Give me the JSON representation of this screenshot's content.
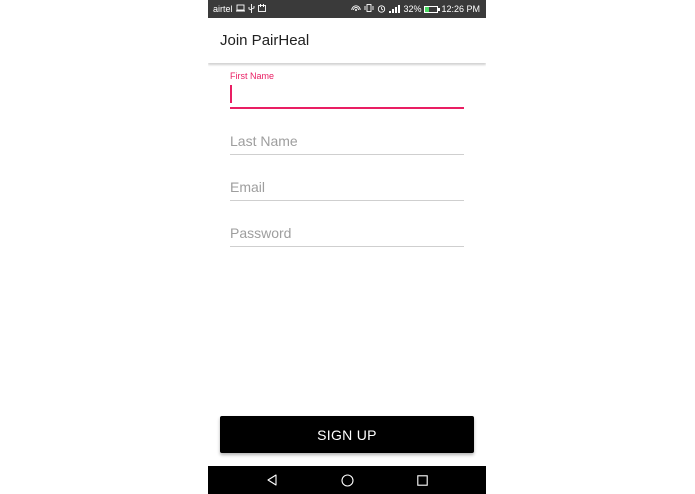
{
  "status_bar": {
    "carrier": "airtel",
    "battery_percent": "32%",
    "battery_level": 0.32,
    "time": "12:26 PM",
    "colors": {
      "background": "#3a3a3a",
      "battery_fill": "#4cd964"
    },
    "icons": [
      "laptop-icon",
      "usb-icon",
      "notification-icon",
      "hotspot-icon",
      "vibrate-icon",
      "alarm-icon",
      "signal-icon",
      "battery-icon"
    ]
  },
  "app_bar": {
    "title": "Join PairHeal"
  },
  "form": {
    "accent_color": "#e91e63",
    "fields": [
      {
        "label": "First Name",
        "value": "",
        "active": true
      },
      {
        "placeholder": "Last Name"
      },
      {
        "placeholder": "Email"
      },
      {
        "placeholder": "Password"
      }
    ]
  },
  "signup": {
    "label": "SIGN UP",
    "background": "#000000"
  },
  "nav_bar": {
    "icons": [
      "back-icon",
      "home-icon",
      "recents-icon"
    ]
  }
}
